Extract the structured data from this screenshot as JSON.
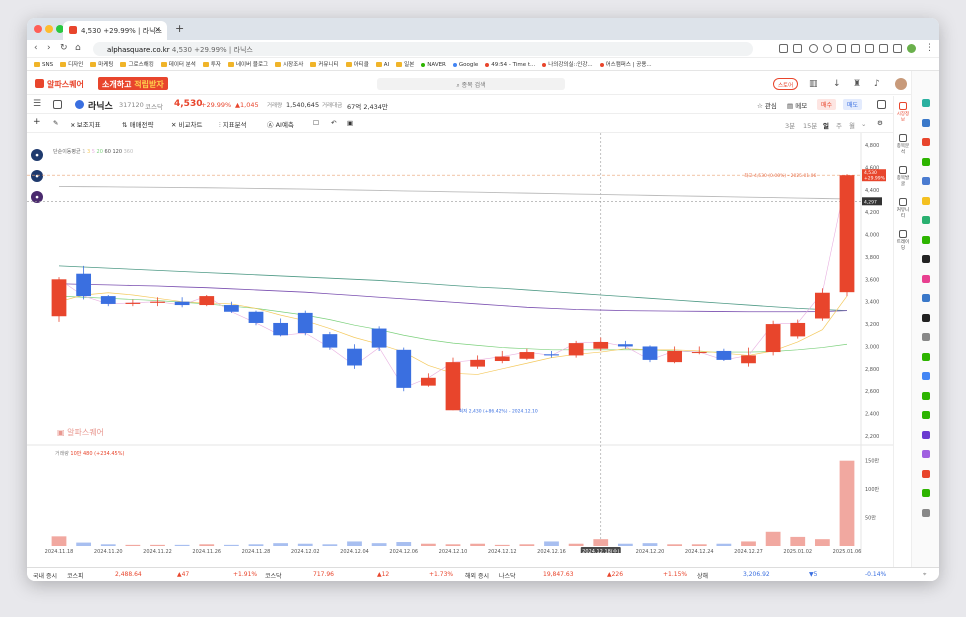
{
  "browser": {
    "tab_title": "4,530 +29.99% | 라닉스",
    "url_domain": "alphasquare.co.kr",
    "url_rest": "4,530 +29.99% | 라닉스",
    "bookmarks": [
      "SNS",
      "디자인",
      "마케팅",
      "그로스해킹",
      "데이터 분석",
      "투자",
      "네이버 블로그",
      "시장조사",
      "커뮤니티",
      "아티클",
      "AI",
      "일본",
      "NAVER",
      "Google",
      "49:54 - Time t...",
      "나의강의실::인강...",
      "어스캠퍼스 | 공용..."
    ]
  },
  "header": {
    "logo": "알파스퀘어",
    "promo_a": "소개하고 ",
    "promo_b": "적립받자",
    "search_placeholder": "종목 검색",
    "store": "스토어"
  },
  "stock": {
    "name": "라닉스",
    "code": "317120",
    "market": "코스닥",
    "price": "4,530",
    "change_pct": "+29.99%",
    "change_abs": "▲1,045",
    "volume_label": "거래량",
    "volume": "1,540,645",
    "amount_label": "거래대금",
    "amount": "67억 2,434만",
    "watch": "관심",
    "memo": "메모",
    "buy": "매수",
    "sell": "매도"
  },
  "toolbar": {
    "items": [
      "보조지표",
      "매매전략",
      "비교차트",
      "지표분석",
      "AI예측"
    ],
    "periods": [
      "3분",
      "15분",
      "일",
      "주",
      "월"
    ],
    "active_period": "일"
  },
  "ma_legend": {
    "label": "단순이동평균",
    "periods": [
      "1",
      "3",
      "5",
      "20",
      "60",
      "120",
      "360"
    ]
  },
  "chart_data": {
    "type": "candlestick",
    "dates": [
      "2024.11.18",
      "2024.11.19",
      "2024.11.20",
      "2024.11.21",
      "2024.11.22",
      "2024.11.25",
      "2024.11.26",
      "2024.11.27",
      "2024.11.28",
      "2024.11.29",
      "2024.12.02",
      "2024.12.03",
      "2024.12.04",
      "2024.12.05",
      "2024.12.06",
      "2024.12.09",
      "2024.12.10",
      "2024.12.11",
      "2024.12.12",
      "2024.12.13",
      "2024.12.16",
      "2024.12.17",
      "2024.12.18",
      "2024.12.19",
      "2024.12.20",
      "2024.12.23",
      "2024.12.24",
      "2024.12.26",
      "2024.12.27",
      "2024.12.30",
      "2025.01.02",
      "2025.01.03",
      "2025.01.06"
    ],
    "open": [
      3270,
      3650,
      3450,
      3380,
      3390,
      3400,
      3370,
      3370,
      3310,
      3210,
      3300,
      3110,
      2980,
      3160,
      2970,
      2650,
      2430,
      2820,
      2870,
      2890,
      2930,
      2920,
      2980,
      3020,
      3000,
      2860,
      2950,
      2960,
      2850,
      2950,
      3090,
      3250,
      3485
    ],
    "close": [
      3600,
      3450,
      3380,
      3390,
      3400,
      3370,
      3450,
      3310,
      3210,
      3100,
      3120,
      2990,
      2830,
      2990,
      2630,
      2720,
      2860,
      2880,
      2910,
      2950,
      2920,
      3030,
      3040,
      3000,
      2880,
      2960,
      2950,
      2880,
      2920,
      3200,
      3210,
      3480,
      4530
    ],
    "high": [
      3620,
      3720,
      3460,
      3420,
      3440,
      3440,
      3460,
      3400,
      3320,
      3250,
      3320,
      3130,
      3020,
      3180,
      2990,
      2760,
      2900,
      2920,
      2960,
      2980,
      2960,
      3050,
      3080,
      3050,
      3010,
      3000,
      3000,
      2980,
      2990,
      3230,
      3240,
      3520,
      4540
    ],
    "low": [
      3220,
      3420,
      3360,
      3360,
      3360,
      3350,
      3360,
      3300,
      3190,
      3090,
      3100,
      2970,
      2800,
      2960,
      2600,
      2640,
      2430,
      2800,
      2850,
      2880,
      2900,
      2900,
      2960,
      2980,
      2860,
      2850,
      2930,
      2870,
      2820,
      2920,
      3070,
      3230,
      3450
    ],
    "volume": [
      17,
      6,
      3,
      2,
      2,
      2,
      3,
      2,
      3,
      5,
      4,
      3,
      8,
      5,
      7,
      4,
      3,
      4,
      2,
      3,
      8,
      4,
      12,
      4,
      5,
      3,
      3,
      4,
      8,
      25,
      16,
      12,
      150
    ],
    "yrange": [
      2200,
      4800
    ],
    "yticks": [
      "4,800",
      "4,600",
      "4,400",
      "4,200",
      "4,000",
      "3,800",
      "3,600",
      "3,400",
      "3,200",
      "3,000",
      "2,800",
      "2,600",
      "2,400",
      "2,200"
    ],
    "vol_ticks": [
      "150만",
      "100만",
      "50만"
    ],
    "x_labels": [
      "2024.11.18",
      "2024.11.20",
      "2024.11.22",
      "2024.11.26",
      "2024.11.28",
      "2024.12.02",
      "2024.12.04",
      "2024.12.06",
      "2024.12.10",
      "2024.12.12",
      "2024.12.16",
      "2024.12.18(수)",
      "2024.12.20",
      "2024.12.24",
      "2024.12.27",
      "2025.01.02",
      "2025.01.06"
    ],
    "price_tag": "4,530",
    "price_tag_pct": "+29.99%",
    "cross_tag": "4,297",
    "high_note": "최고 4,530 (0.00%) - 2025.01.06",
    "low_note": "최저 2,430 (+86.42%) - 2024.12.10",
    "volume_label": "거래량",
    "volume_value": "10만 480 (+234.45%)",
    "watermark": "알파스퀘어",
    "ma20": [
      3450,
      3440,
      3430,
      3420,
      3410,
      3395,
      3380,
      3360,
      3340,
      3310,
      3280,
      3240,
      3190,
      3150,
      3100,
      3060,
      3030,
      3010,
      2990,
      2980,
      2970,
      2970,
      2970,
      2970,
      2970,
      2960,
      2950,
      2950,
      2950,
      2955,
      2970,
      2990,
      3020
    ],
    "ma60": [
      3560,
      3555,
      3550,
      3545,
      3540,
      3532,
      3525,
      3515,
      3505,
      3495,
      3485,
      3470,
      3455,
      3440,
      3425,
      3410,
      3395,
      3380,
      3365,
      3350,
      3340,
      3330,
      3325,
      3320,
      3318,
      3316,
      3314,
      3312,
      3310,
      3310,
      3310,
      3312,
      3320
    ],
    "ma120": [
      3720,
      3710,
      3700,
      3690,
      3680,
      3670,
      3660,
      3650,
      3640,
      3630,
      3620,
      3610,
      3600,
      3590,
      3575,
      3560,
      3545,
      3530,
      3520,
      3505,
      3490,
      3475,
      3460,
      3445,
      3430,
      3415,
      3400,
      3385,
      3370,
      3355,
      3340,
      3330,
      3320
    ],
    "ma360": [
      4430,
      4428,
      4426,
      4424,
      4422,
      4420,
      4418,
      4415,
      4412,
      4409,
      4406,
      4402,
      4398,
      4394,
      4390,
      4386,
      4382,
      4378,
      4374,
      4370,
      4366,
      4362,
      4358,
      4354,
      4350,
      4346,
      4342,
      4338,
      4334,
      4330,
      4326,
      4322,
      4318
    ],
    "ma5": [
      3400,
      3460,
      3480,
      3460,
      3430,
      3400,
      3390,
      3380,
      3340,
      3280,
      3230,
      3160,
      3080,
      3020,
      2950,
      2830,
      2760,
      2750,
      2800,
      2850,
      2900,
      2930,
      2950,
      2980,
      2970,
      2970,
      2960,
      2940,
      2920,
      2960,
      3040,
      3150,
      3450
    ]
  },
  "sidebar": [
    "시장정보",
    "종목분석",
    "종목발굴",
    "커뮤니티",
    "트레이딩"
  ],
  "footer": {
    "domestic": "국내 증시",
    "kospi_label": "코스피",
    "kospi": "2,488.64",
    "kospi_chg": "▲47",
    "kospi_pct": "+1.91%",
    "kosdaq_label": "코스닥",
    "kosdaq": "717.96",
    "kosdaq_chg": "▲12",
    "kosdaq_pct": "+1.73%",
    "overseas": "해외 증시",
    "nasdaq_label": "나스닥",
    "nasdaq": "19,847.63",
    "nasdaq_chg": "▲226",
    "nasdaq_pct": "+1.15%",
    "sh_label": "상해",
    "sh": "3,206.92",
    "sh_chg": "▼5",
    "sh_pct": "-0.14%"
  }
}
